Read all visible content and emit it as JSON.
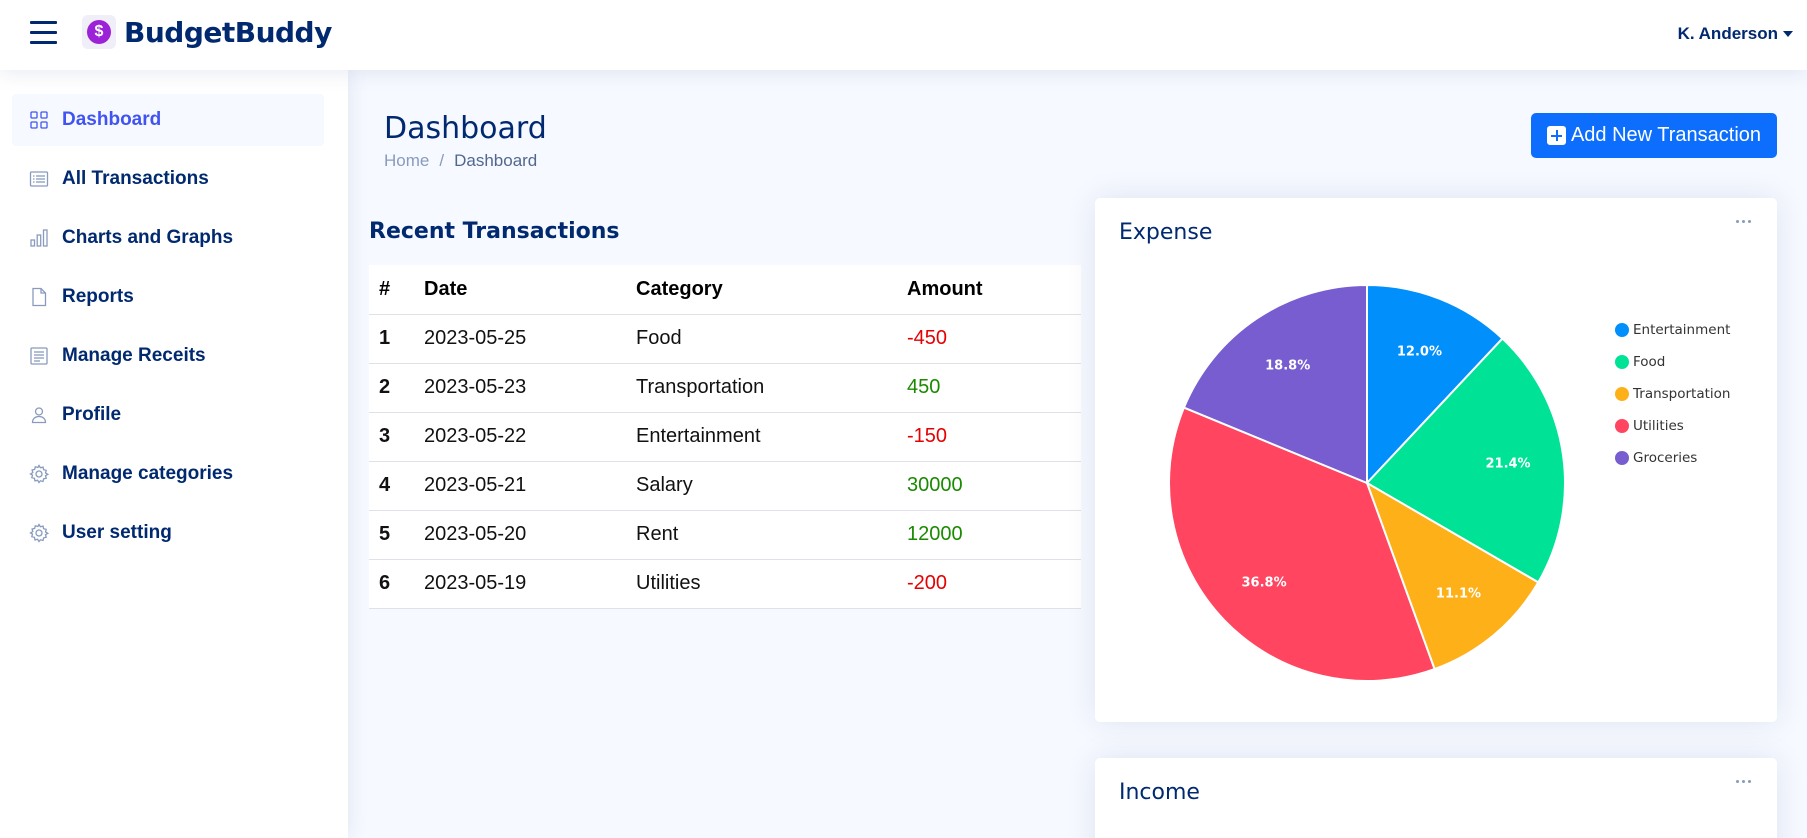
{
  "header": {
    "brand": "BudgetBuddy",
    "logo_glyph": "$",
    "user_name": "K. Anderson"
  },
  "sidebar": {
    "items": [
      {
        "label": "Dashboard",
        "icon": "grid-icon",
        "active": true
      },
      {
        "label": "All Transactions",
        "icon": "list-icon"
      },
      {
        "label": "Charts and Graphs",
        "icon": "bar-chart-icon"
      },
      {
        "label": "Reports",
        "icon": "file-icon"
      },
      {
        "label": "Manage Receits",
        "icon": "receipt-icon"
      },
      {
        "label": "Profile",
        "icon": "person-icon"
      },
      {
        "label": "Manage categories",
        "icon": "gear-icon"
      },
      {
        "label": "User setting",
        "icon": "gear-icon"
      }
    ]
  },
  "page": {
    "title": "Dashboard",
    "breadcrumb_home": "Home",
    "breadcrumb_sep": "/",
    "breadcrumb_current": "Dashboard",
    "add_button": "Add New Transaction"
  },
  "recent": {
    "title": "Recent Transactions",
    "columns": [
      "#",
      "Date",
      "Category",
      "Amount"
    ],
    "rows": [
      {
        "num": "1",
        "date": "2023-05-25",
        "category": "Food",
        "amount": "-450",
        "type": "neg"
      },
      {
        "num": "2",
        "date": "2023-05-23",
        "category": "Transportation",
        "amount": "450",
        "type": "pos"
      },
      {
        "num": "3",
        "date": "2023-05-22",
        "category": "Entertainment",
        "amount": "-150",
        "type": "neg"
      },
      {
        "num": "4",
        "date": "2023-05-21",
        "category": "Salary",
        "amount": "30000",
        "type": "pos"
      },
      {
        "num": "5",
        "date": "2023-05-20",
        "category": "Rent",
        "amount": "12000",
        "type": "pos"
      },
      {
        "num": "6",
        "date": "2023-05-19",
        "category": "Utilities",
        "amount": "-200",
        "type": "neg"
      }
    ]
  },
  "expense_card": {
    "title": "Expense"
  },
  "income_card": {
    "title": "Income"
  },
  "chart_data": {
    "type": "pie",
    "title": "Expense",
    "categories": [
      "Entertainment",
      "Food",
      "Transportation",
      "Utilities",
      "Groceries"
    ],
    "values": [
      12.0,
      21.4,
      11.1,
      36.8,
      18.8
    ],
    "labels": [
      "12.0%",
      "21.4%",
      "11.1%",
      "36.8%",
      "18.8%"
    ],
    "colors": [
      "#008ffb",
      "#00e396",
      "#feb019",
      "#ff4560",
      "#775dd0"
    ],
    "legend": "right"
  }
}
